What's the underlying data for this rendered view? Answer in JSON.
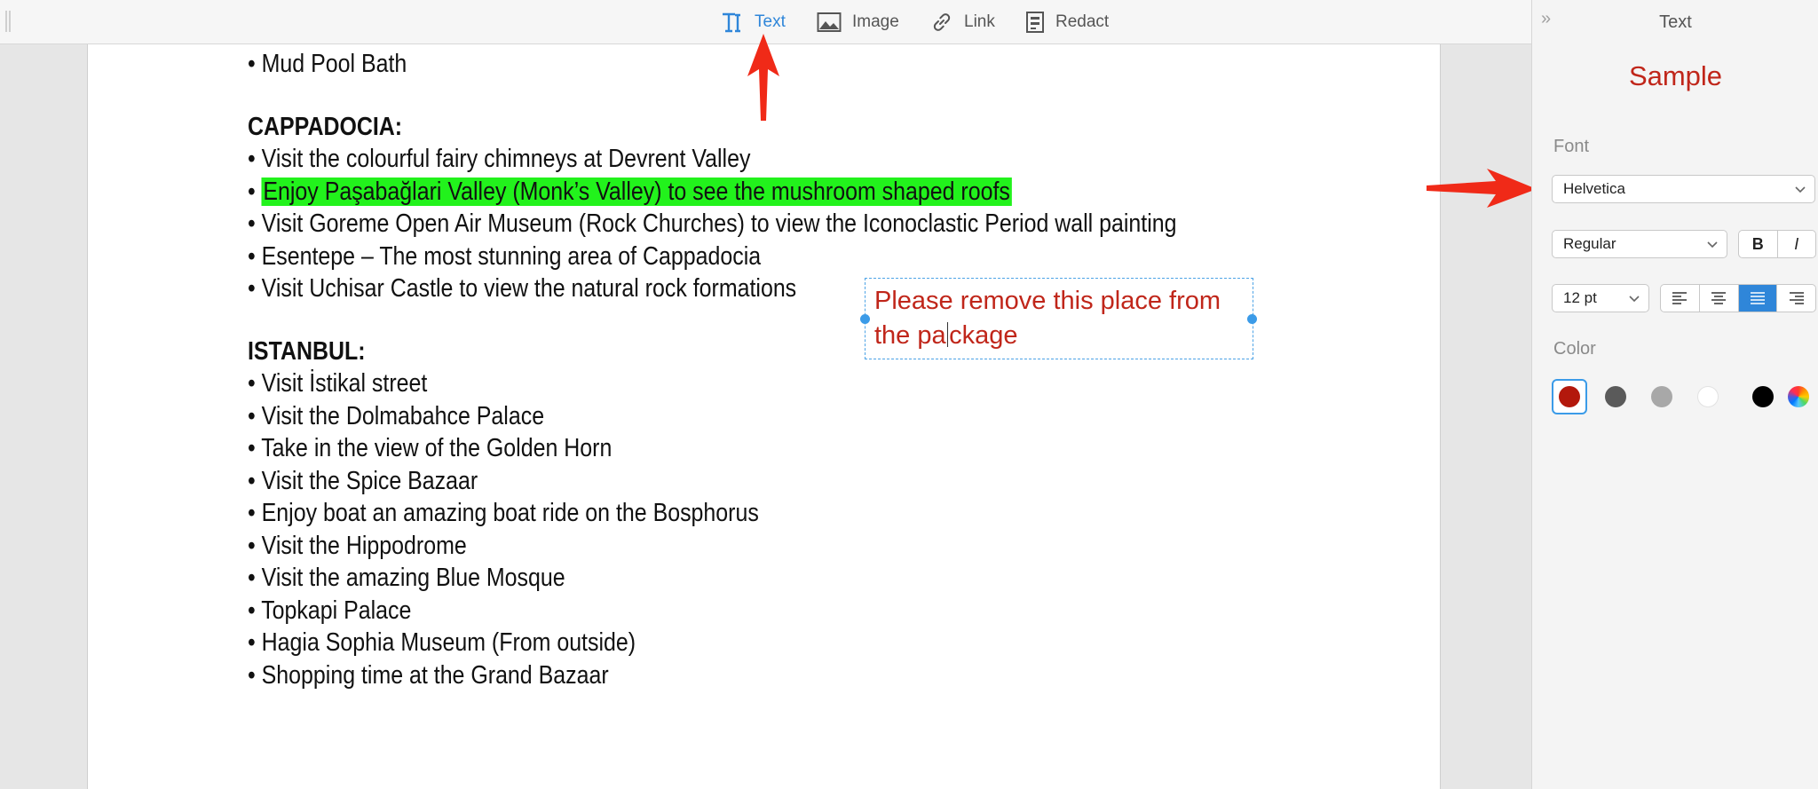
{
  "toolbar": {
    "tools": [
      {
        "id": "text",
        "label": "Text",
        "icon": "text-tool-icon",
        "active": true
      },
      {
        "id": "image",
        "label": "Image",
        "icon": "image-icon",
        "active": false
      },
      {
        "id": "link",
        "label": "Link",
        "icon": "link-icon",
        "active": false
      },
      {
        "id": "redact",
        "label": "Redact",
        "icon": "redact-icon",
        "active": false
      }
    ]
  },
  "document": {
    "lines": [
      {
        "text": "• Mud Pool Bath"
      },
      {
        "text": ""
      },
      {
        "text": "CAPPADOCIA:",
        "heading": true
      },
      {
        "text": "• Visit the colourful fairy chimneys at Devrent Valley"
      },
      {
        "bullet": "• ",
        "highlight": "Enjoy Paşabağlari Valley (Monk’s Valley) to see the mushroom shaped roofs"
      },
      {
        "text": "• Visit Goreme Open Air Museum (Rock Churches) to view the Iconoclastic Period wall painting"
      },
      {
        "text": "• Esentepe – The most stunning area of Cappadocia"
      },
      {
        "text": "• Visit Uchisar Castle to view the natural rock formations"
      },
      {
        "text": ""
      },
      {
        "text": "ISTANBUL:",
        "heading": true
      },
      {
        "text": "• Visit İstikal street"
      },
      {
        "text": "• Visit the Dolmabahce Palace"
      },
      {
        "text": "• Take in the view of the Golden Horn"
      },
      {
        "text": "• Visit the Spice Bazaar"
      },
      {
        "text": "• Enjoy boat an amazing boat ride on the Bosphorus"
      },
      {
        "text": "• Visit the Hippodrome"
      },
      {
        "text": "• Visit the amazing Blue Mosque"
      },
      {
        "text": "• Topkapi Palace"
      },
      {
        "text": "• Hagia Sophia Museum (From outside)"
      },
      {
        "text": "• Shopping time at the Grand Bazaar"
      }
    ],
    "comment": {
      "line1": "Please remove this place from",
      "line2_before_caret": "the pa",
      "line2_after_caret": "ckage"
    }
  },
  "panel": {
    "title": "Text",
    "sample": "Sample",
    "font_label": "Font",
    "font_family": "Helvetica",
    "font_style": "Regular",
    "bold_label": "B",
    "italic_label": "I",
    "font_size": "12 pt",
    "alignment_selected": "justify",
    "color_label": "Color",
    "colors": [
      "#b3180c",
      "#5a5a5a",
      "#a8a8a8",
      "#ffffff",
      "#000000",
      "color-wheel"
    ],
    "selected_color": "#b3180c"
  },
  "colors": {
    "accent": "#2f86d9",
    "annotation_red": "#c0261a",
    "highlight_green": "#22f21c",
    "arrow_red": "#f02a18"
  }
}
